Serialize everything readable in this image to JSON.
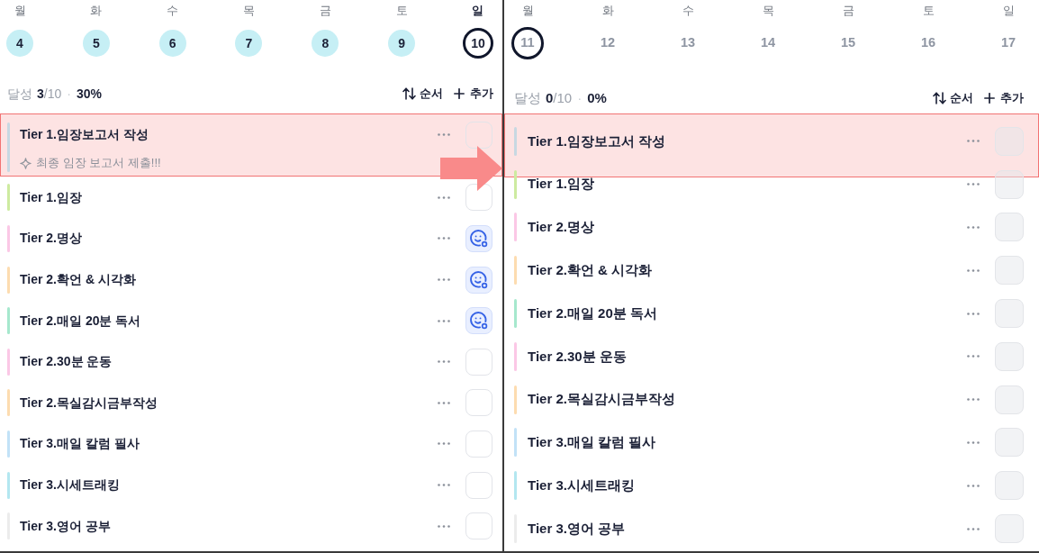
{
  "panels": [
    {
      "days": [
        {
          "weekday": "월",
          "date": "4",
          "completed": true,
          "selected": false,
          "today": false,
          "future": false
        },
        {
          "weekday": "화",
          "date": "5",
          "completed": true,
          "selected": false,
          "today": false,
          "future": false
        },
        {
          "weekday": "수",
          "date": "6",
          "completed": true,
          "selected": false,
          "today": false,
          "future": false
        },
        {
          "weekday": "목",
          "date": "7",
          "completed": true,
          "selected": false,
          "today": false,
          "future": false
        },
        {
          "weekday": "금",
          "date": "8",
          "completed": true,
          "selected": false,
          "today": false,
          "future": false
        },
        {
          "weekday": "토",
          "date": "9",
          "completed": true,
          "selected": false,
          "today": false,
          "future": false
        },
        {
          "weekday": "일",
          "date": "10",
          "completed": false,
          "selected": true,
          "today": true,
          "future": false
        }
      ],
      "summary": {
        "label": "달성",
        "done": "3",
        "total": "/10",
        "separator": "·",
        "percent": "30%"
      },
      "actions": [
        {
          "kind": "sort",
          "label": "순서"
        },
        {
          "kind": "add",
          "label": "추가"
        }
      ],
      "items": [
        {
          "title": "Tier 1.임장보고서 작성",
          "color": "#c8d8e2",
          "note": "최종 임장 보고서 제출!!!",
          "checked": false,
          "disabled": false,
          "highlighted": true
        },
        {
          "title": "Tier 1.임장",
          "color": "#cdeba0",
          "checked": false,
          "disabled": false,
          "highlighted": false
        },
        {
          "title": "Tier 2.명상",
          "color": "#fbc8e6",
          "checked": true,
          "disabled": false,
          "highlighted": false
        },
        {
          "title": "Tier 2.확언 & 시각화",
          "color": "#fddcb0",
          "checked": true,
          "disabled": false,
          "highlighted": false
        },
        {
          "title": "Tier 2.매일 20분 독서",
          "color": "#a6e8cd",
          "checked": true,
          "disabled": false,
          "highlighted": false
        },
        {
          "title": "Tier 2.30분 운동",
          "color": "#fbc8e6",
          "checked": false,
          "disabled": false,
          "highlighted": false
        },
        {
          "title": "Tier 2.목실감시금부작성",
          "color": "#fddcb0",
          "checked": false,
          "disabled": false,
          "highlighted": false
        },
        {
          "title": "Tier 3.매일 칼럼 필사",
          "color": "#c2e2f7",
          "checked": false,
          "disabled": false,
          "highlighted": false
        },
        {
          "title": "Tier 3.시세트래킹",
          "color": "#b3e7f0",
          "checked": false,
          "disabled": false,
          "highlighted": false
        },
        {
          "title": "Tier 3.영어 공부",
          "color": "#ececec",
          "checked": false,
          "disabled": false,
          "highlighted": false
        }
      ]
    },
    {
      "days": [
        {
          "weekday": "월",
          "date": "11",
          "completed": false,
          "selected": true,
          "today": false,
          "future": true
        },
        {
          "weekday": "화",
          "date": "12",
          "completed": false,
          "selected": false,
          "today": false,
          "future": true
        },
        {
          "weekday": "수",
          "date": "13",
          "completed": false,
          "selected": false,
          "today": false,
          "future": true
        },
        {
          "weekday": "목",
          "date": "14",
          "completed": false,
          "selected": false,
          "today": false,
          "future": true
        },
        {
          "weekday": "금",
          "date": "15",
          "completed": false,
          "selected": false,
          "today": false,
          "future": true
        },
        {
          "weekday": "토",
          "date": "16",
          "completed": false,
          "selected": false,
          "today": false,
          "future": true
        },
        {
          "weekday": "일",
          "date": "17",
          "completed": false,
          "selected": false,
          "today": false,
          "future": true
        }
      ],
      "summary": {
        "label": "달성",
        "done": "0",
        "total": "/10",
        "separator": "·",
        "percent": "0%"
      },
      "actions": [
        {
          "kind": "sort",
          "label": "순서"
        },
        {
          "kind": "add",
          "label": "추가"
        }
      ],
      "items": [
        {
          "title": "Tier 1.임장보고서 작성",
          "color": "#c8d8e2",
          "checked": false,
          "disabled": true,
          "highlighted": true
        },
        {
          "title": "Tier 1.임장",
          "color": "#cdeba0",
          "checked": false,
          "disabled": true,
          "highlighted": false
        },
        {
          "title": "Tier 2.명상",
          "color": "#fbc8e6",
          "checked": false,
          "disabled": true,
          "highlighted": false
        },
        {
          "title": "Tier 2.확언 & 시각화",
          "color": "#fddcb0",
          "checked": false,
          "disabled": true,
          "highlighted": false
        },
        {
          "title": "Tier 2.매일 20분 독서",
          "color": "#a6e8cd",
          "checked": false,
          "disabled": true,
          "highlighted": false
        },
        {
          "title": "Tier 2.30분 운동",
          "color": "#fbc8e6",
          "checked": false,
          "disabled": true,
          "highlighted": false
        },
        {
          "title": "Tier 2.목실감시금부작성",
          "color": "#fddcb0",
          "checked": false,
          "disabled": true,
          "highlighted": false
        },
        {
          "title": "Tier 3.매일 칼럼 필사",
          "color": "#c2e2f7",
          "checked": false,
          "disabled": true,
          "highlighted": false
        },
        {
          "title": "Tier 3.시세트래킹",
          "color": "#b3e7f0",
          "checked": false,
          "disabled": true,
          "highlighted": false
        },
        {
          "title": "Tier 3.영어 공부",
          "color": "#ececec",
          "checked": false,
          "disabled": true,
          "highlighted": false
        }
      ]
    }
  ]
}
